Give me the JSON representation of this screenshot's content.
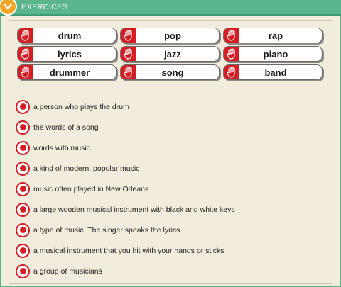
{
  "header": {
    "title": "EXERCICES"
  },
  "words": [
    {
      "label": "drum"
    },
    {
      "label": "pop"
    },
    {
      "label": "rap"
    },
    {
      "label": "lyrics"
    },
    {
      "label": "jazz"
    },
    {
      "label": "piano"
    },
    {
      "label": "drummer"
    },
    {
      "label": "song"
    },
    {
      "label": "band"
    }
  ],
  "definitions": [
    {
      "text": "a person who plays the drum"
    },
    {
      "text": "the words of a song"
    },
    {
      "text": "words with music"
    },
    {
      "text": "a kind of modern, popular music"
    },
    {
      "text": "music often played in New Orleans"
    },
    {
      "text": "a large wooden musical instrument with black and white keys"
    },
    {
      "text": "a type of music. The singer speaks the lyrics"
    },
    {
      "text": "a musical instrument that you hit with your hands or sticks"
    },
    {
      "text": "a group of musicians"
    }
  ],
  "colors": {
    "header": "#5bb58c",
    "badge": "#f1a526",
    "accent_red": "#d51d24",
    "background": "#f1ecdc"
  },
  "icons": {
    "badge": "chevron-down-icon",
    "tile": "hand-icon",
    "target": "radio-target-icon"
  }
}
